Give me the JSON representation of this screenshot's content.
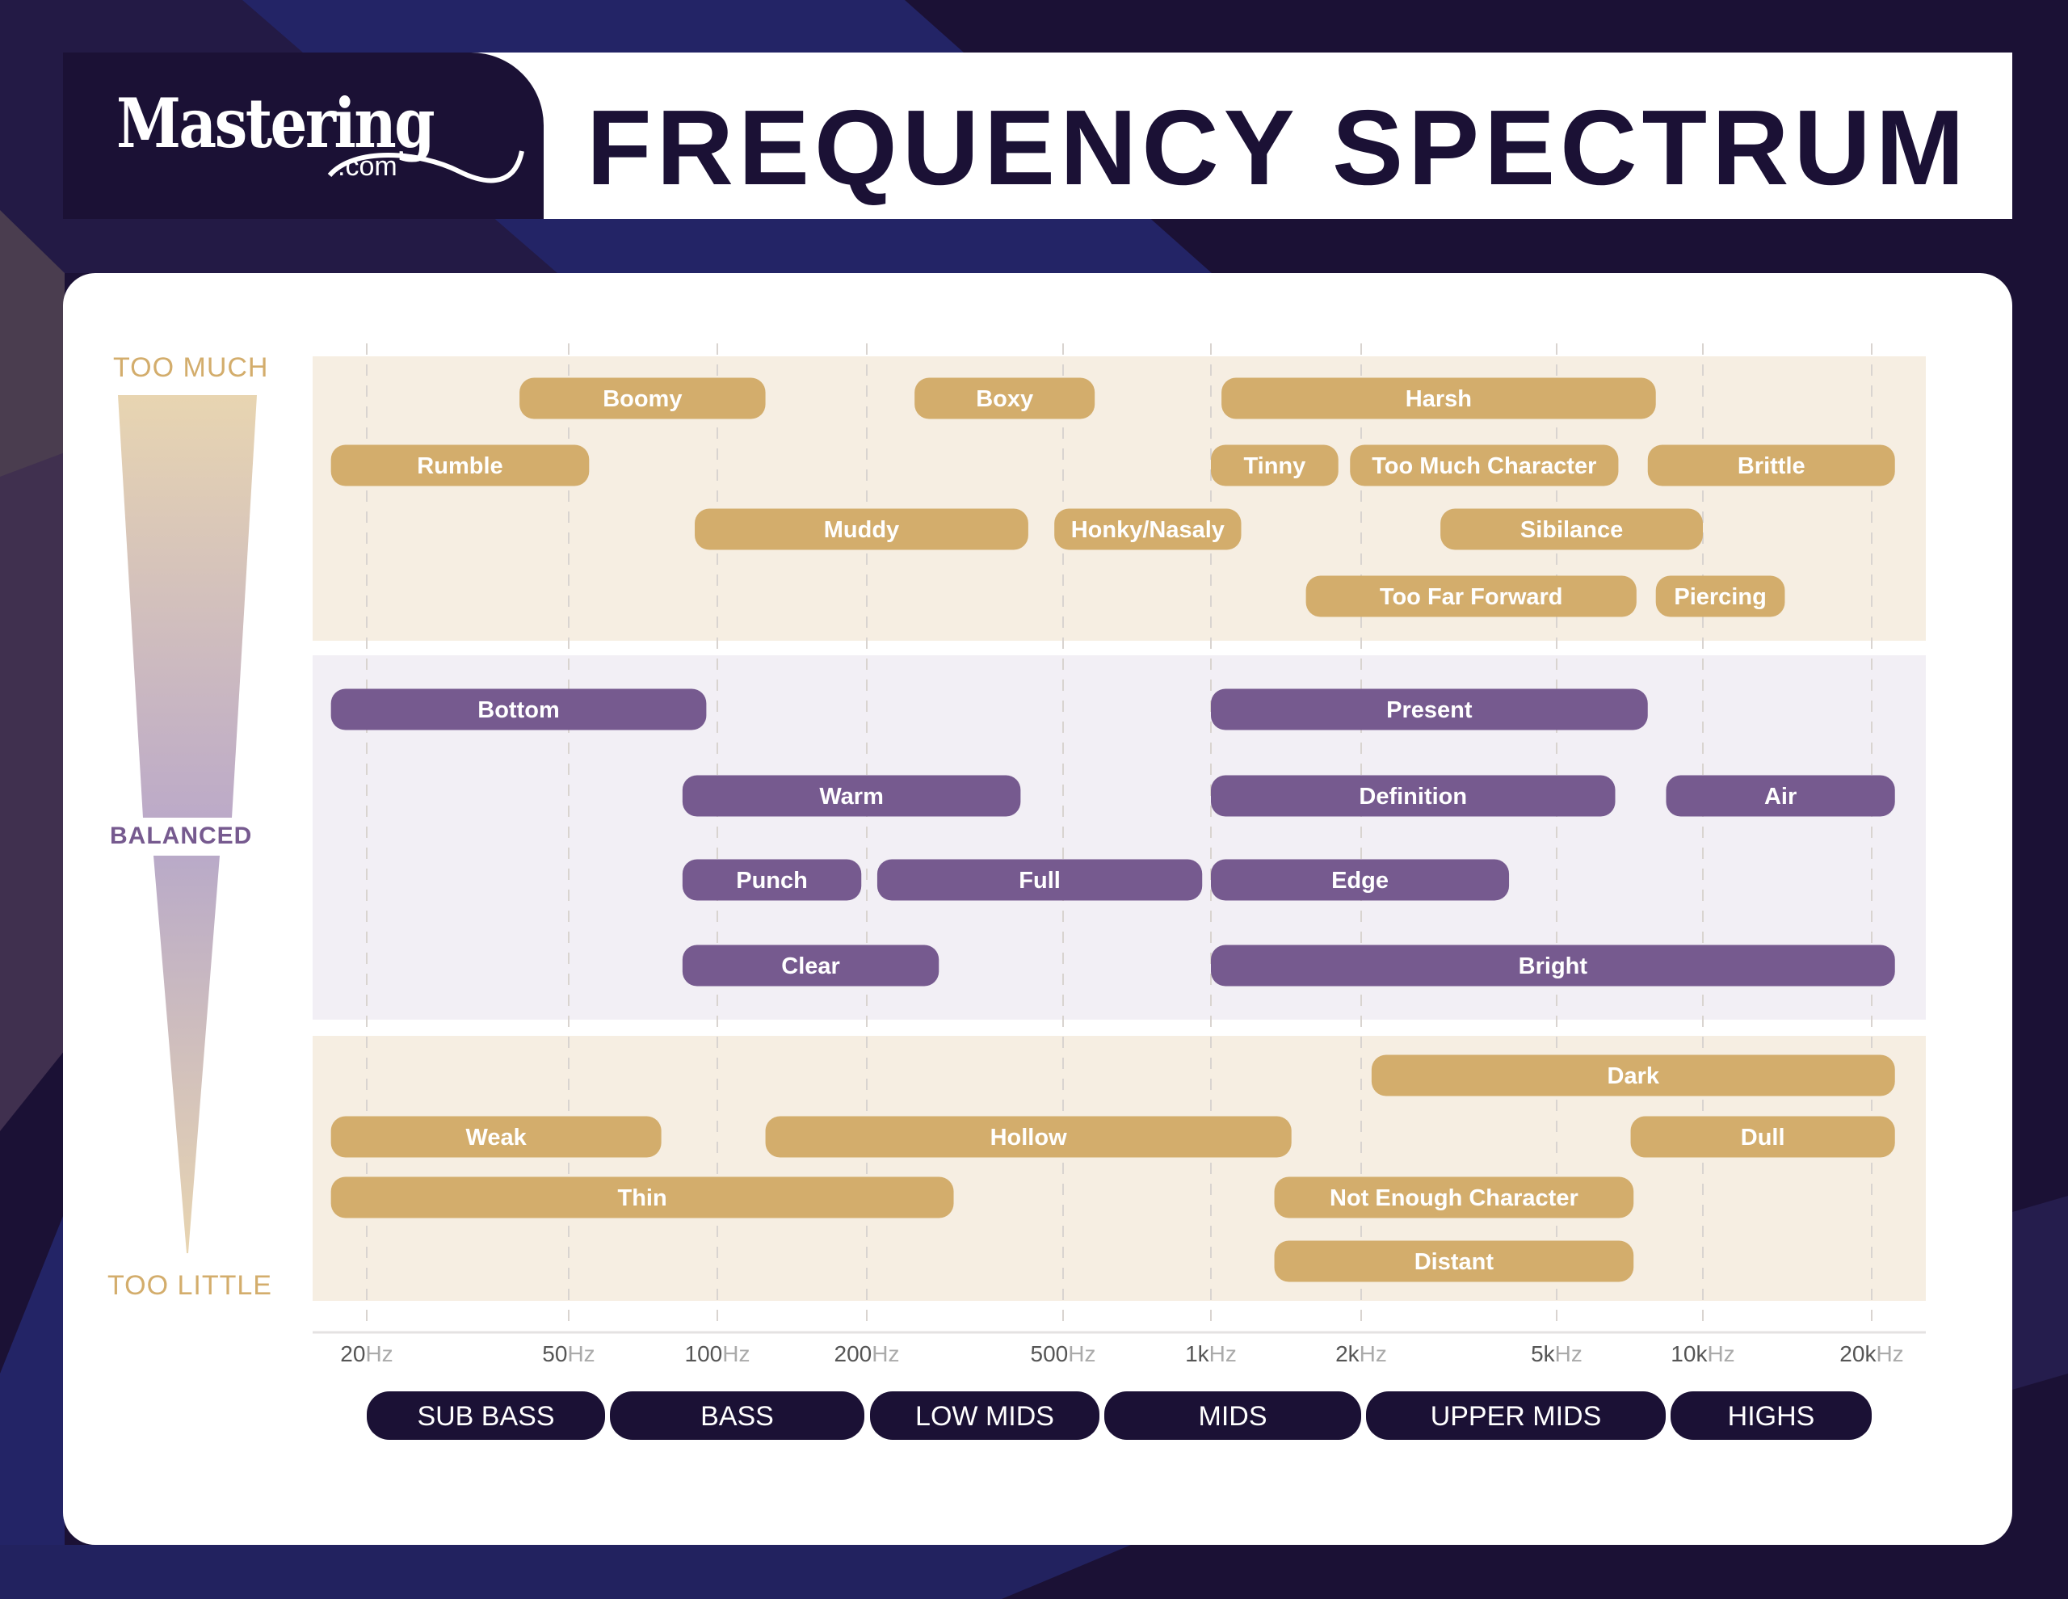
{
  "header": {
    "logo_main": "Mastering",
    "logo_sub": ".com",
    "title": "FREQUENCY SPECTRUM"
  },
  "colors": {
    "navy": "#1b1135",
    "gold": "#d3ad6c",
    "purple": "#765a8f",
    "gold_band": "#f6eee2",
    "purple_band": "#f2eff5"
  },
  "scale": {
    "top": "TOO MUCH",
    "middle": "BALANCED",
    "bottom": "TOO LITTLE"
  },
  "chart_data": {
    "type": "range-bar",
    "title": "FREQUENCY SPECTRUM",
    "x_scale": "log",
    "x_unit": "Hz",
    "xlim": [
      17,
      22000
    ],
    "ticks": [
      {
        "value": 20,
        "num": "20",
        "unit": "Hz"
      },
      {
        "value": 50,
        "num": "50",
        "unit": "Hz"
      },
      {
        "value": 100,
        "num": "100",
        "unit": "Hz"
      },
      {
        "value": 200,
        "num": "200",
        "unit": "Hz"
      },
      {
        "value": 500,
        "num": "500",
        "unit": "Hz"
      },
      {
        "value": 1000,
        "num": "1k",
        "unit": "Hz"
      },
      {
        "value": 2000,
        "num": "2k",
        "unit": "Hz"
      },
      {
        "value": 5000,
        "num": "5k",
        "unit": "Hz"
      },
      {
        "value": 10000,
        "num": "10k",
        "unit": "Hz"
      },
      {
        "value": 20000,
        "num": "20k",
        "unit": "Hz"
      }
    ],
    "ranges": [
      {
        "label": "SUB BASS",
        "from": 20,
        "to": 60
      },
      {
        "label": "BASS",
        "from": 60,
        "to": 250
      },
      {
        "label": "LOW MIDS",
        "from": 250,
        "to": 500
      },
      {
        "label": "MIDS",
        "from": 500,
        "to": 2000
      },
      {
        "label": "UPPER MIDS",
        "from": 2000,
        "to": 8000
      },
      {
        "label": "HIGHS",
        "from": 8000,
        "to": 20000
      }
    ],
    "bands": [
      {
        "name": "Too Much",
        "color": "gold",
        "items": [
          {
            "label": "Boomy",
            "from": 40,
            "to": 125,
            "row": 0
          },
          {
            "label": "Boxy",
            "from": 250,
            "to": 580,
            "row": 0
          },
          {
            "label": "Harsh",
            "from": 1050,
            "to": 8000,
            "row": 0
          },
          {
            "label": "Rumble",
            "from": 17,
            "to": 55,
            "row": 1
          },
          {
            "label": "Tinny",
            "from": 1000,
            "to": 1800,
            "row": 1
          },
          {
            "label": "Too Much Character",
            "from": 1900,
            "to": 6700,
            "row": 1
          },
          {
            "label": "Brittle",
            "from": 7700,
            "to": 22000,
            "row": 1
          },
          {
            "label": "Muddy",
            "from": 90,
            "to": 425,
            "row": 2
          },
          {
            "label": "Honky/Nasaly",
            "from": 480,
            "to": 1150,
            "row": 2
          },
          {
            "label": "Sibilance",
            "from": 2900,
            "to": 10000,
            "row": 2
          },
          {
            "label": "Too Far Forward",
            "from": 1550,
            "to": 7300,
            "row": 3
          },
          {
            "label": "Piercing",
            "from": 8000,
            "to": 14000,
            "row": 3
          }
        ]
      },
      {
        "name": "Balanced",
        "color": "purple",
        "items": [
          {
            "label": "Bottom",
            "from": 17,
            "to": 95,
            "row": 0
          },
          {
            "label": "Present",
            "from": 1000,
            "to": 7700,
            "row": 0
          },
          {
            "label": "Warm",
            "from": 85,
            "to": 410,
            "row": 1
          },
          {
            "label": "Definition",
            "from": 1000,
            "to": 6600,
            "row": 1
          },
          {
            "label": "Air",
            "from": 8400,
            "to": 22000,
            "row": 1
          },
          {
            "label": "Punch",
            "from": 85,
            "to": 195,
            "row": 2
          },
          {
            "label": "Full",
            "from": 210,
            "to": 960,
            "row": 2
          },
          {
            "label": "Edge",
            "from": 1000,
            "to": 4000,
            "row": 2
          },
          {
            "label": "Clear",
            "from": 85,
            "to": 280,
            "row": 3
          },
          {
            "label": "Bright",
            "from": 1000,
            "to": 22000,
            "row": 3
          }
        ]
      },
      {
        "name": "Too Little",
        "color": "gold",
        "items": [
          {
            "label": "Dark",
            "from": 2100,
            "to": 22000,
            "row": 0
          },
          {
            "label": "Weak",
            "from": 17,
            "to": 77,
            "row": 1
          },
          {
            "label": "Hollow",
            "from": 125,
            "to": 1450,
            "row": 1
          },
          {
            "label": "Dull",
            "from": 7100,
            "to": 22000,
            "row": 1
          },
          {
            "label": "Thin",
            "from": 17,
            "to": 300,
            "row": 2
          },
          {
            "label": "Not Enough Character",
            "from": 1340,
            "to": 7200,
            "row": 2
          },
          {
            "label": "Distant",
            "from": 1340,
            "to": 7200,
            "row": 3
          }
        ]
      }
    ]
  }
}
